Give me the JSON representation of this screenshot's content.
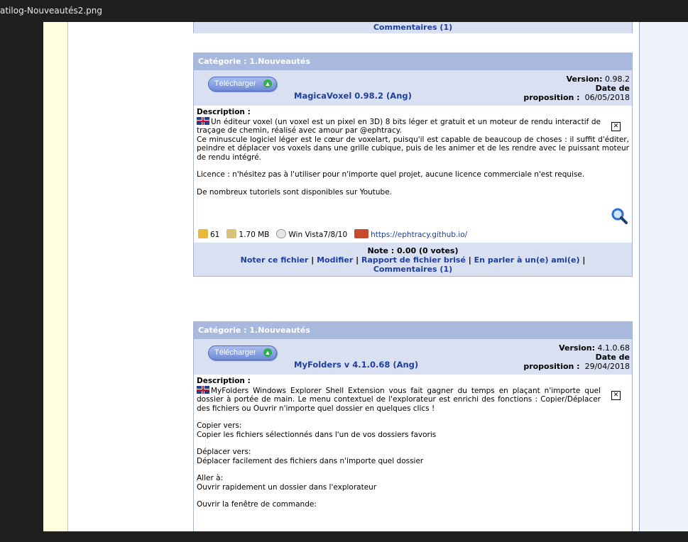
{
  "window": {
    "title": "atilog-Nouveautés2.png"
  },
  "top_partial": {
    "comments_link": "Commentaires (1)"
  },
  "entries": [
    {
      "category": "Catégorie : 1.Nouveautés",
      "download_label": "Télécharger",
      "name": "MagicaVoxel 0.98.2 (Ang)",
      "version_label": "Version:",
      "version": "0.98.2",
      "date_label_1": "Date de",
      "date_label_2": "proposition :",
      "date": "06/05/2018",
      "description_label": "Description :",
      "desc_p1": "Un éditeur voxel (un voxel est un pixel en 3D) 8 bits léger et gratuit et un moteur de rendu interactif de traçage de chemin, réalisé avec amour par @ephtracy.",
      "desc_p1b": "Ce minuscule logiciel léger est le cœur de voxelart, puisqu'il est capable de beaucoup de choses : il suffit d'éditer, peindre et déplacer vos voxels dans une grille cubique, puis de les animer et de les rendre avec le puissant moteur de rendu intégré.",
      "desc_p2": "Licence : n'hésitez pas à l'utiliser pour n'importe quel projet, aucune licence commerciale n'est requise.",
      "desc_p3": "De nombreux tutoriels sont disponibles sur Youtube.",
      "hits": "61",
      "size": "1.70 MB",
      "os": "Win Vista7/8/10",
      "homepage": "https://ephtracy.github.io/",
      "note": "Note : 0.00 (0 votes)",
      "links": [
        "Noter ce fichier",
        "Modifier",
        "Rapport de fichier brisé",
        "En parler à un(e) ami(e)"
      ],
      "comments": "Commentaires (1)"
    },
    {
      "category": "Catégorie : 1.Nouveautés",
      "download_label": "Télécharger",
      "name": "MyFolders v 4.1.0.68 (Ang)",
      "version_label": "Version:",
      "version": "4.1.0.68",
      "date_label_1": "Date de",
      "date_label_2": "proposition :",
      "date": "29/04/2018",
      "description_label": "Description :",
      "desc_p1": "MyFolders Windows Explorer Shell Extension vous fait gagner du temps en plaçant n'importe quel dossier à portée de main. Le menu contextuel de l'explorateur est enrichi des fonctions : Copier/Déplacer des fichiers ou Ouvrir n'importe quel dossier en quelques clics !",
      "sections": [
        {
          "title": "Copier vers:",
          "text": "Copier les fichiers sélectionnés dans l'un de vos dossiers favoris"
        },
        {
          "title": "Déplacer vers:",
          "text": "Déplacer facilement des fichiers dans n'importe quel dossier"
        },
        {
          "title": "Aller à:",
          "text": "Ouvrir rapidement un dossier dans l'explorateur"
        },
        {
          "title": "Ouvrir la fenêtre de commande:",
          "text": ""
        }
      ]
    }
  ],
  "icons": [
    "uk-flag-icon",
    "close-box-icon",
    "magnifier-icon",
    "hits-icon",
    "filesize-icon",
    "os-icon",
    "homepage-icon",
    "download-arrow-icon"
  ],
  "colors": {
    "header": "#a9b9dd",
    "row": "#d8e0f2",
    "link": "#1f3fa0",
    "side": "#ffffdf"
  }
}
